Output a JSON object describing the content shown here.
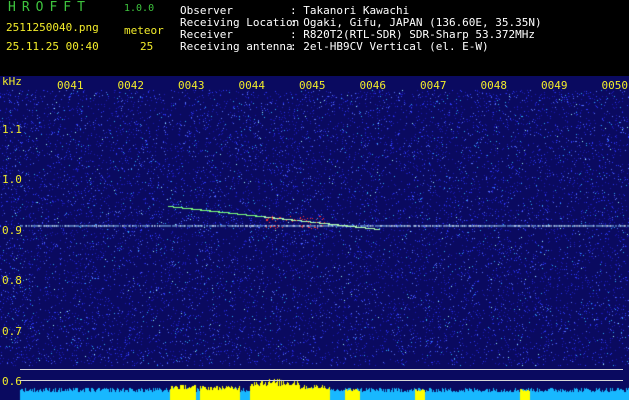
{
  "header": {
    "app_title": "HROFFT",
    "app_version": "1.0.0",
    "file_name": "2511250040.png",
    "date_time": "25.11.25 00:40",
    "meteor_label": "meteor",
    "meteor_count": "25",
    "info": [
      {
        "label": "Observer",
        "value": ": Takanori Kawachi"
      },
      {
        "label": "Receiving Location",
        "value": ": Ogaki, Gifu, JAPAN (136.60E, 35.35N)"
      },
      {
        "label": "Receiver",
        "value": ": R820T2(RTL-SDR) SDR-Sharp 53.372MHz"
      },
      {
        "label": "Receiving antenna",
        "value": ": 2el-HB9CV Vertical (el. E-W)"
      }
    ]
  },
  "axes": {
    "unit": "kHz",
    "time_labels": [
      "0041",
      "0042",
      "0043",
      "0044",
      "0045",
      "0046",
      "0047",
      "0048",
      "0049",
      "0050"
    ],
    "freq_labels": [
      {
        "label": "1.1",
        "value": 1.1
      },
      {
        "label": "1.0",
        "value": 1.0
      },
      {
        "label": "0.9",
        "value": 0.9
      },
      {
        "label": "0.8",
        "value": 0.8
      },
      {
        "label": "0.7",
        "value": 0.7
      },
      {
        "label": "0.6",
        "value": 0.6
      }
    ]
  },
  "colors": {
    "background": "#0a0a60",
    "axis_text": "#f2ec2a",
    "header_green": "#3ec43e",
    "carrier": "#8fd0ff",
    "meteor_head": "#ff3030",
    "meteor_trail": "#7cff7c",
    "level_bar": "#ffff00",
    "baseline": "#18b8ff"
  }
}
